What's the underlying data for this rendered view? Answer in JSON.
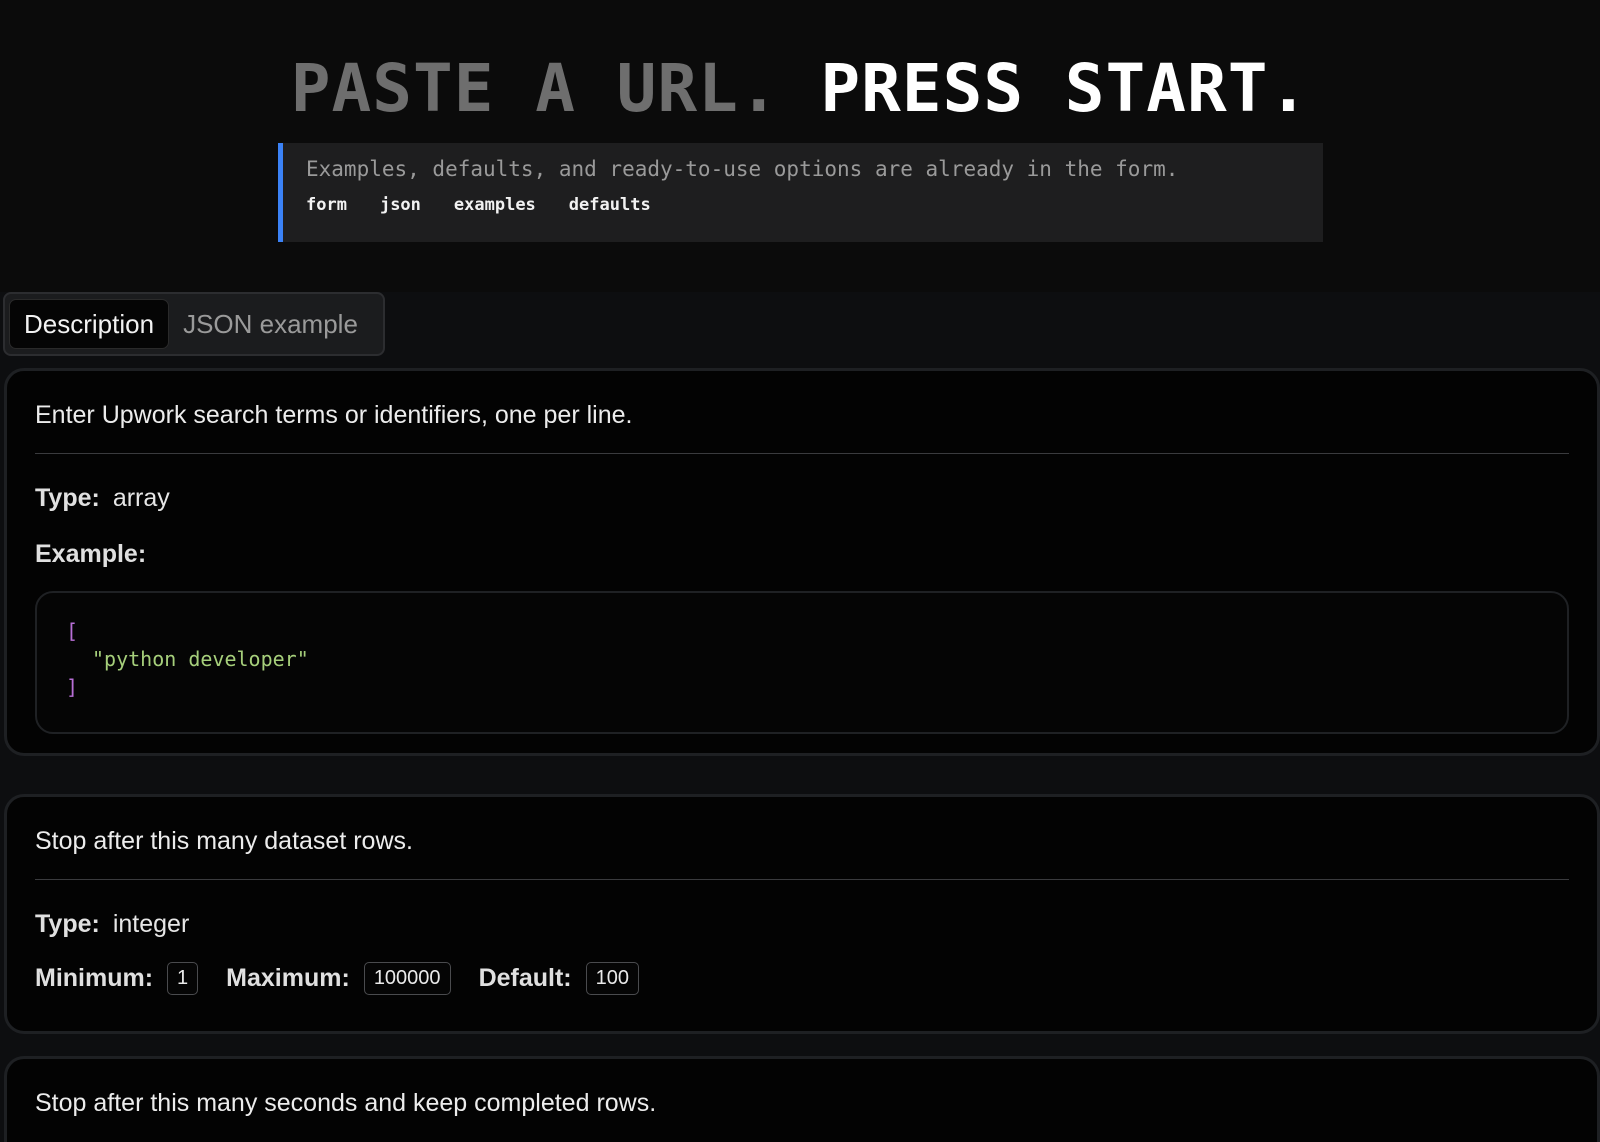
{
  "hero": {
    "title_muted": "PASTE A URL.",
    "title_bright": "PRESS START.",
    "callout_text": "Examples, defaults, and ready-to-use options are already in the form.",
    "tags": [
      "form",
      "json",
      "examples",
      "defaults"
    ]
  },
  "colors": {
    "accent": "#3b82f6",
    "code_bracket": "#b86fd6",
    "code_string": "#a6cf7b"
  },
  "tabs": [
    {
      "label": "Description",
      "active": true
    },
    {
      "label": "JSON example",
      "active": false
    }
  ],
  "fields": [
    {
      "description": "Enter Upwork search terms or identifiers, one per line.",
      "type_label": "Type:",
      "type": "array",
      "example_label": "Example:",
      "example_open": "[",
      "example_item": "\"python developer\"",
      "example_close": "]"
    },
    {
      "description": "Stop after this many dataset rows.",
      "type_label": "Type:",
      "type": "integer",
      "minimum_label": "Minimum:",
      "minimum": "1",
      "maximum_label": "Maximum:",
      "maximum": "100000",
      "default_label": "Default:",
      "default": "100"
    },
    {
      "description": "Stop after this many seconds and keep completed rows."
    }
  ]
}
